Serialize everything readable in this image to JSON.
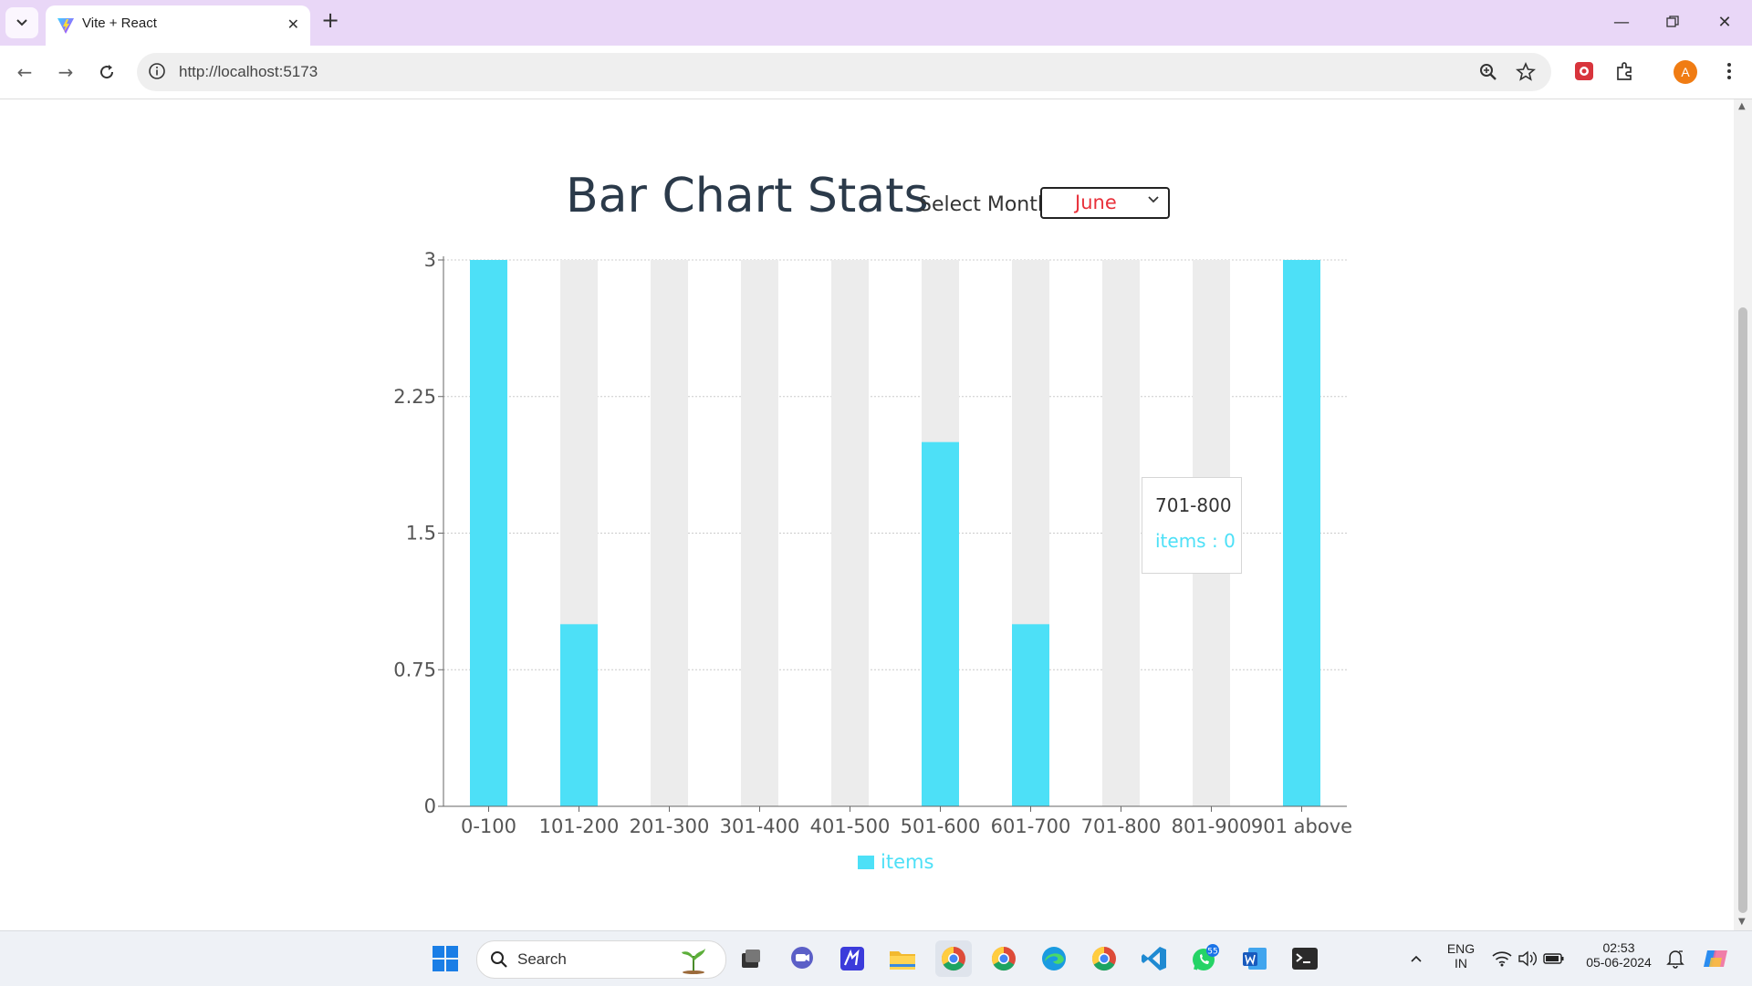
{
  "browser": {
    "tab_title": "Vite + React",
    "url": "http://localhost:5173",
    "profile_initial": "A"
  },
  "page": {
    "heading": "Bar Chart Stats",
    "select_label": "Select Month",
    "selected_month": "June"
  },
  "chart_data": {
    "type": "bar",
    "categories": [
      "0-100",
      "101-200",
      "201-300",
      "301-400",
      "401-500",
      "501-600",
      "601-700",
      "701-800",
      "801-900",
      "901 above"
    ],
    "series": [
      {
        "name": "items",
        "values": [
          3,
          1,
          0,
          0,
          0,
          2,
          1,
          0,
          0,
          3
        ],
        "color": "#4de0f7"
      }
    ],
    "ylim": [
      0,
      3
    ],
    "yticks": [
      "0",
      "0.75",
      "1.5",
      "2.25",
      "3"
    ],
    "grid": true,
    "legend": "bottom-center",
    "highlight_background_color": "#ececec",
    "tooltip": {
      "category": "701-800",
      "series": "items",
      "value": 0
    }
  },
  "tooltip": {
    "title": "701-800",
    "series_label": "items",
    "separator": " : ",
    "value": "0"
  },
  "taskbar": {
    "search_label": "Search",
    "whatsapp_badge": "55",
    "lang_line1": "ENG",
    "lang_line2": "IN",
    "time": "02:53",
    "date": "05-06-2024"
  },
  "colors": {
    "bar": "#4de0f7",
    "heading": "#2b3a4a",
    "select_value": "#e8303a",
    "tabstrip": "#e9d7f7"
  }
}
